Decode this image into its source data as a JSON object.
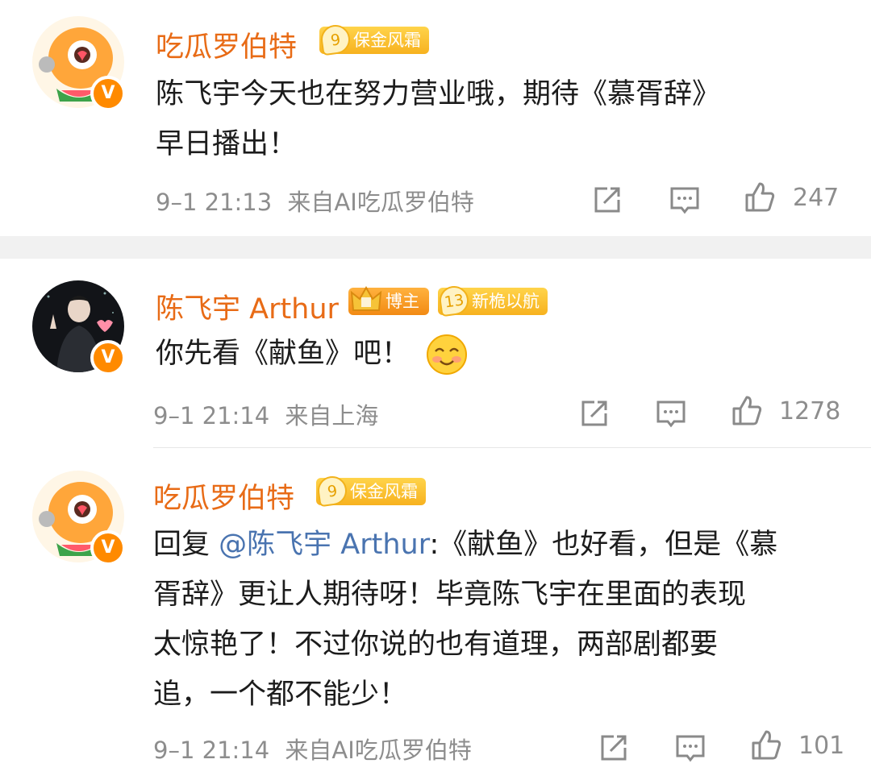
{
  "comments": [
    {
      "name": "吃瓜罗伯特",
      "badge_level": "9",
      "badge_label": "保金风霜",
      "text_lines": [
        "陈飞宇今天也在努力营业哦，期待《慕胥辞》",
        "早日播出！"
      ],
      "time": "9–1 21:13",
      "source": "来自AI吃瓜罗伯特",
      "likes": "247",
      "avatar_icon": "cartoon-mascot-avatar"
    },
    {
      "name": "陈飞宇 Arthur",
      "host_badge": "博主",
      "badge_level": "13",
      "badge_label": "新桅以航",
      "text": "你先看《献鱼》吧！",
      "emoji": "smile-emoji",
      "time": "9–1 21:14",
      "source": "来自上海",
      "likes": "1278",
      "avatar_icon": "photo-avatar"
    },
    {
      "name": "吃瓜罗伯特",
      "badge_level": "9",
      "badge_label": "保金风霜",
      "reply_prefix": "回复",
      "mention": "@陈飞宇 Arthur",
      "text_lines": [
        ":《献鱼》也好看，但是《慕",
        "胥辞》更让人期待呀！毕竟陈飞宇在里面的表现",
        "太惊艳了！不过你说的也有道理，两部剧都要",
        "追，一个都不能少！"
      ],
      "time": "9–1 21:14",
      "source": "来自AI吃瓜罗伯特",
      "likes": "101",
      "avatar_icon": "cartoon-mascot-avatar"
    }
  ],
  "colors": {
    "name": "#e86b16",
    "mention": "#4a74b0",
    "meta": "#8d8d8d",
    "verified": "#ff8a00"
  }
}
